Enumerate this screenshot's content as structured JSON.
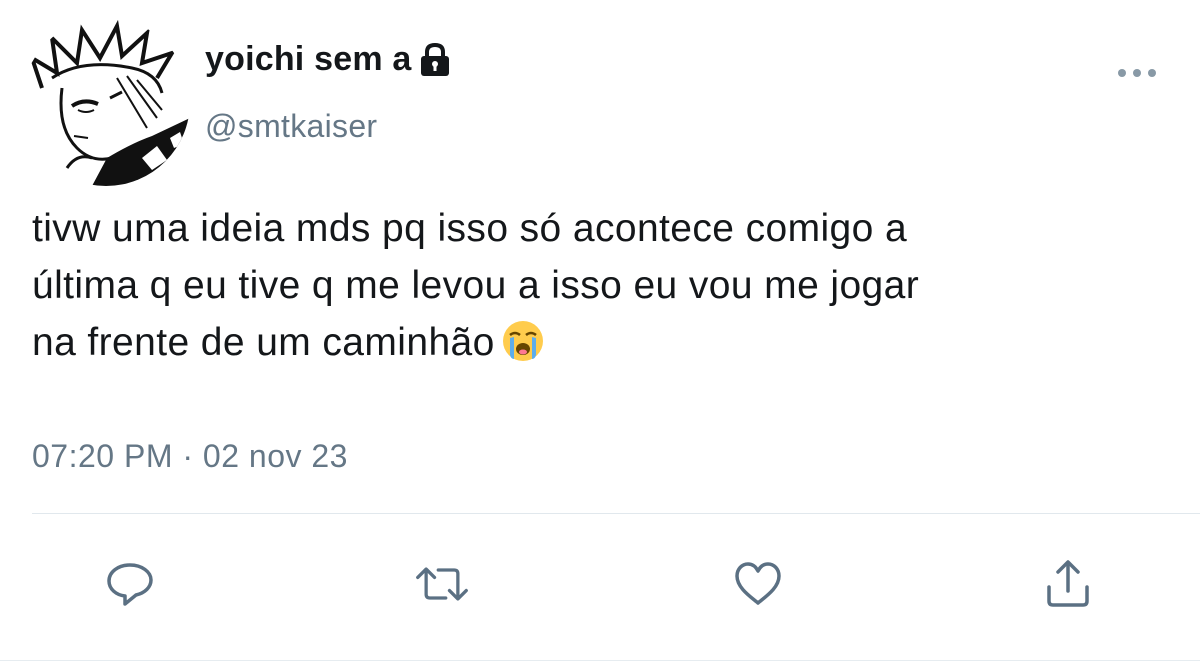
{
  "author": {
    "display_name": "yoichi sem a",
    "handle": "@smtkaiser",
    "avatar_icon": "anime-character-avatar",
    "lock_icon": "lock-icon"
  },
  "tweet": {
    "lines": [
      "tivw uma ideia mds pq isso só acontece comigo a",
      "última q eu tive q me levou a isso eu vou me jogar",
      "na frente de um caminhão"
    ],
    "emoji": "loudly-crying-face",
    "timestamp": "07:20 PM · 02 nov 23"
  },
  "actions": {
    "reply_icon": "reply-icon",
    "retweet_icon": "retweet-icon",
    "like_icon": "like-icon",
    "share_icon": "share-icon",
    "more_icon": "more-icon"
  },
  "colors": {
    "text": "#14171a",
    "secondary": "#657786",
    "icon": "#5b7083",
    "divider": "#e1e8ed"
  }
}
